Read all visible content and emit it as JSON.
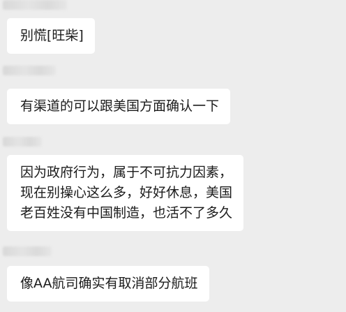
{
  "chat": {
    "messages": [
      {
        "lines": [
          "别慌[旺柴]"
        ]
      },
      {
        "lines": [
          "有渠道的可以跟美国方面确认一下"
        ]
      },
      {
        "lines": [
          "因为政府行为，属于不可抗力因素，",
          "现在别操心这么多，好好休息，美国",
          "老百姓没有中国制造，也活不了多久"
        ]
      },
      {
        "lines": [
          "像AA航司确实有取消部分航班"
        ]
      }
    ]
  }
}
